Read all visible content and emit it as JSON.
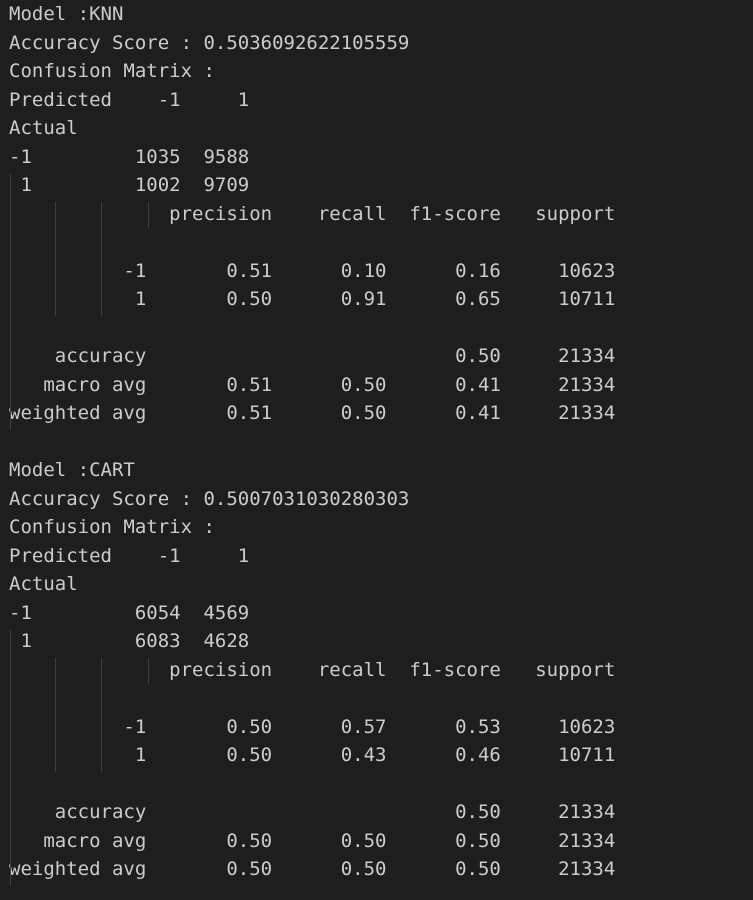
{
  "output_lines": [
    "Model :KNN",
    "Accuracy Score : 0.5036092622105559",
    "Confusion Matrix :",
    "Predicted    -1     1",
    "Actual",
    "-1         1035  9588",
    " 1         1002  9709",
    "              precision    recall  f1-score   support",
    "",
    "          -1       0.51      0.10      0.16     10623",
    "           1       0.50      0.91      0.65     10711",
    "",
    "    accuracy                           0.50     21334",
    "   macro avg       0.51      0.50      0.41     21334",
    "weighted avg       0.51      0.50      0.41     21334",
    "",
    "Model :CART",
    "Accuracy Score : 0.5007031030280303",
    "Confusion Matrix :",
    "Predicted    -1     1",
    "Actual",
    "-1         6054  4569",
    " 1         6083  4628",
    "              precision    recall  f1-score   support",
    "",
    "          -1       0.50      0.57      0.53     10623",
    "           1       0.50      0.43      0.46     10711",
    "",
    "    accuracy                           0.50     21334",
    "   macro avg       0.50      0.50      0.50     21334",
    "weighted avg       0.50      0.50      0.50     21334"
  ]
}
